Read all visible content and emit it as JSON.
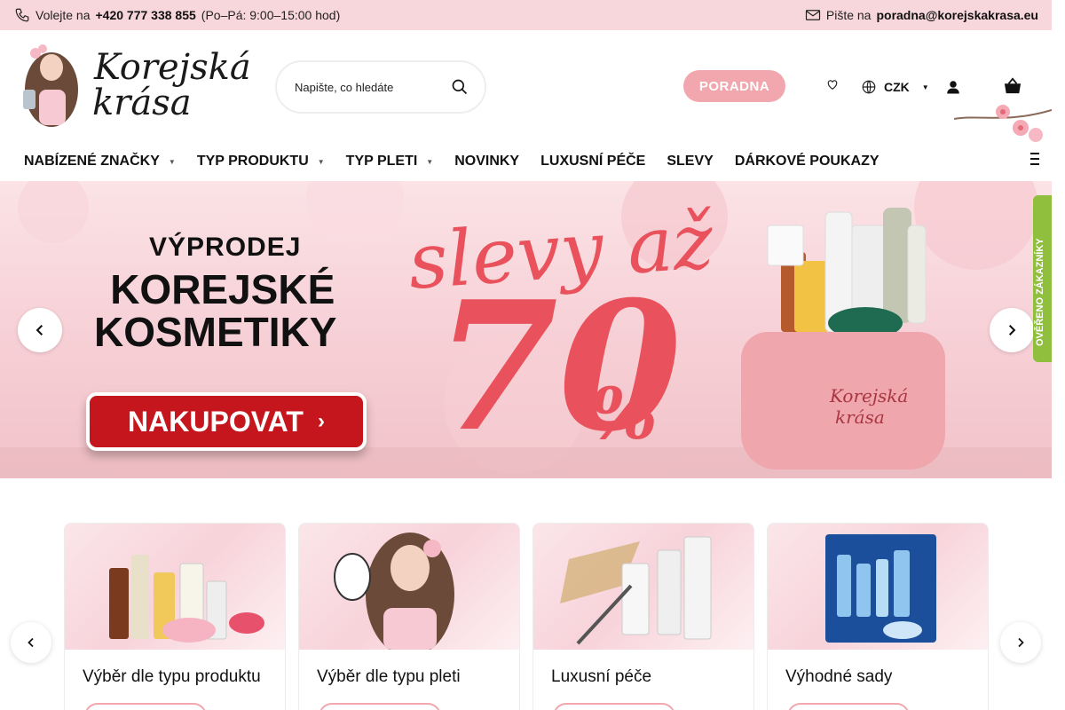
{
  "topbar": {
    "call_prefix": "Volejte na",
    "phone": "+420 777 338 855",
    "hours": "(Po–Pá: 9:00–15:00 hod)",
    "write_prefix": "Pište na",
    "email": "poradna@korejskakrasa.eu"
  },
  "header": {
    "logo_line1": "Korejská",
    "logo_line2": "krása",
    "search_placeholder": "Napište, co hledáte",
    "poradna_label": "PORADNA",
    "currency": "CZK"
  },
  "nav": {
    "items": [
      {
        "label": "NABÍZENÉ ZNAČKY"
      },
      {
        "label": "TYP PRODUKTU"
      },
      {
        "label": "TYP PLETI"
      },
      {
        "label": "NOVINKY"
      },
      {
        "label": "LUXUSNÍ PÉČE"
      },
      {
        "label": "SLEVY"
      },
      {
        "label": "DÁRKOVÉ POUKAZY"
      }
    ]
  },
  "banner": {
    "line1": "VÝPRODEJ",
    "line2": "KOREJSKÉ",
    "line3": "KOSMETIKY",
    "cta": "NAKUPOVAT",
    "slevy": "slevy až",
    "percent_value": "70",
    "percent_sign": "%",
    "bag_line1": "Korejská",
    "bag_line2": "krása",
    "verified_badge": "OVĚŘENO ZÁKAZNÍKY"
  },
  "cards": [
    {
      "title": "Výběr dle typu produktu"
    },
    {
      "title": "Výběr dle typu pleti"
    },
    {
      "title": "Luxusní péče"
    },
    {
      "title": "Výhodné sady"
    }
  ],
  "colors": {
    "topbar_bg": "#f7d6dc",
    "accent_pink": "#f2a7ae",
    "cta_red": "#c4161c",
    "banner_pink": "#e9525c",
    "verified_green": "#8fbf3c"
  }
}
